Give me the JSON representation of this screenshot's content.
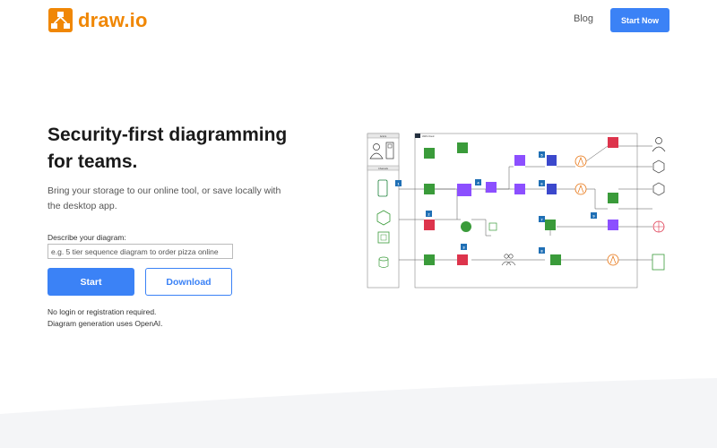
{
  "header": {
    "logo_text": "draw.io",
    "blog_label": "Blog",
    "start_now_label": "Start Now"
  },
  "hero": {
    "headline_line1": "Security-first diagramming",
    "headline_line2": "for teams.",
    "subtext_line1": "Bring your storage to our online tool, or save locally with",
    "subtext_line2": "the desktop app.",
    "describe_label": "Describe your diagram:",
    "describe_placeholder": "e.g. 5 tier sequence diagram to order pizza online",
    "start_label": "Start",
    "download_label": "Download",
    "note_line1": "No login or registration required.",
    "note_line2": "Diagram generation uses OpenAI."
  },
  "colors": {
    "brand_orange": "#f08705",
    "primary_blue": "#3b82f6"
  },
  "diagram": {
    "actors_title": "Actors",
    "channels_title": "Channels",
    "aws_cloud_label": "AWS Cloud",
    "badges": [
      "1",
      "2",
      "3",
      "4",
      "5",
      "6",
      "7",
      "8",
      "9"
    ]
  }
}
